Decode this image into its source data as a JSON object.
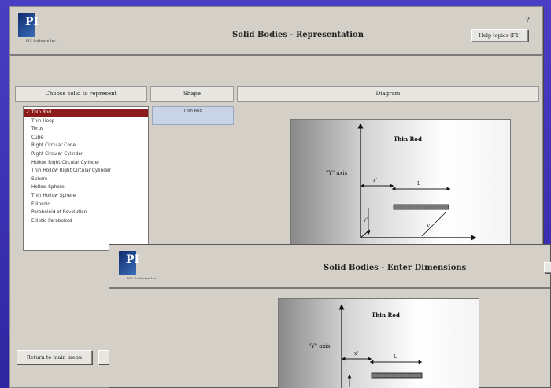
{
  "main_window": {
    "logo": {
      "mark": "PI",
      "tagline": "PCI Software Inc."
    },
    "title": "Solid Bodies - Representation",
    "help_icon": "?",
    "help_button": "Help topics (F1)",
    "solid_panel": {
      "header": "Choose solid to represent",
      "items": [
        "Thin Rod",
        "Thin Hoop",
        "Torus",
        "Cube",
        "Right Circular Cone",
        "Right Circular Cylinder",
        "Hollow Right Circular Cylinder",
        "Thin Hollow Right Circular Cylinder",
        "Sphere",
        "Hollow Sphere",
        "Thin Hollow Sphere",
        "Ellipsoid",
        "Paraboloid of Revolution",
        "Elliptic Paraboloid"
      ],
      "selected_index": 0
    },
    "shape_panel": {
      "header": "Shape",
      "items": [
        "Thin Rod"
      ]
    },
    "diagram_panel": {
      "header": "Diagram",
      "title": "Thin Rod",
      "axis_label": "\"Y\" axis",
      "label_x": "x'",
      "label_l": "L",
      "label_y": "y'",
      "label_v": "V'"
    },
    "return_button": "Return to main menu"
  },
  "dimension_window": {
    "logo": {
      "mark": "PI",
      "tagline": "PCI Software Inc."
    },
    "title": "Solid Bodies - Enter Dimensions",
    "diagram": {
      "title": "Thin Rod",
      "axis_label": "\"Y\" axis",
      "label_x": "x'",
      "label_l": "L"
    }
  }
}
